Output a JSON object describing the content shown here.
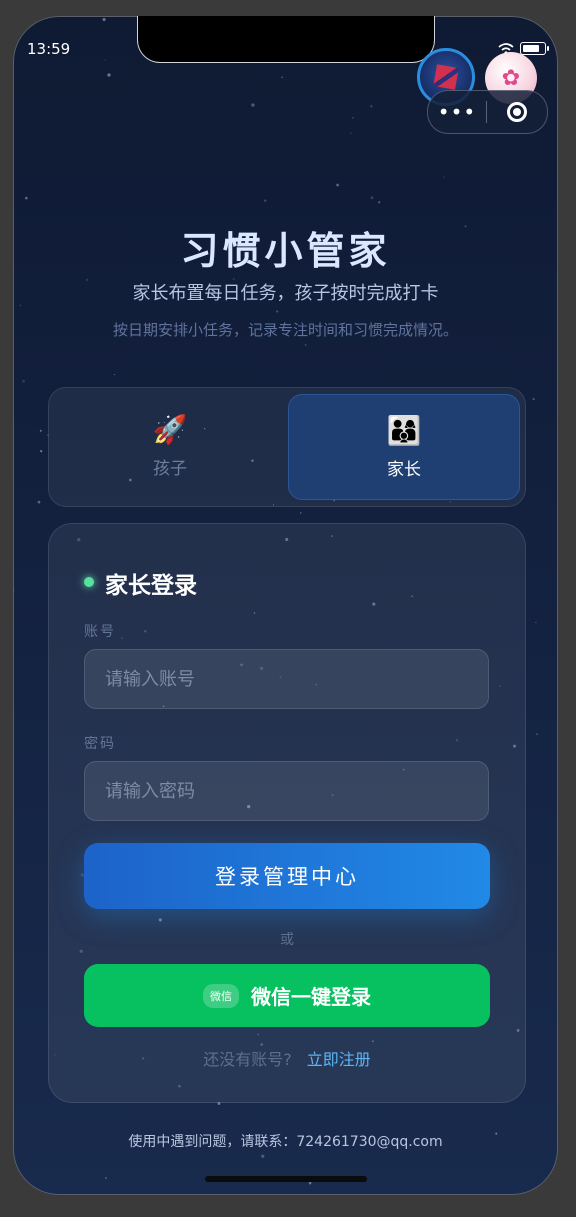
{
  "status_bar": {
    "time": "13:59"
  },
  "header": {
    "title": "习惯小管家",
    "subtitle": "家长布置每日任务，孩子按时完成打卡",
    "description": "按日期安排小任务，记录专注时间和习惯完成情况。"
  },
  "roles": {
    "selected": "家长",
    "child": {
      "icon": "rocket-icon",
      "emoji": "🚀",
      "label": "孩子"
    },
    "parent": {
      "icon": "family-icon",
      "emoji": "👨‍👩‍👦",
      "label": "家长"
    }
  },
  "login": {
    "title": "家长登录",
    "account_label": "账号",
    "account_placeholder": "请输入账号",
    "password_label": "密码",
    "password_placeholder": "请输入密码",
    "submit_label": "登录管理中心",
    "or_label": "或",
    "wechat_badge": "微信",
    "wechat_label": "微信一键登录",
    "register_prompt": "还没有账号?",
    "register_link": "立即注册"
  },
  "footer": {
    "contact": "使用中遇到问题，请联系：724261730@qq.com"
  },
  "colors": {
    "accent": "#2189e6",
    "wechat": "#07c160",
    "status_dot": "#5ae0a0",
    "link": "#5bb4f5"
  }
}
